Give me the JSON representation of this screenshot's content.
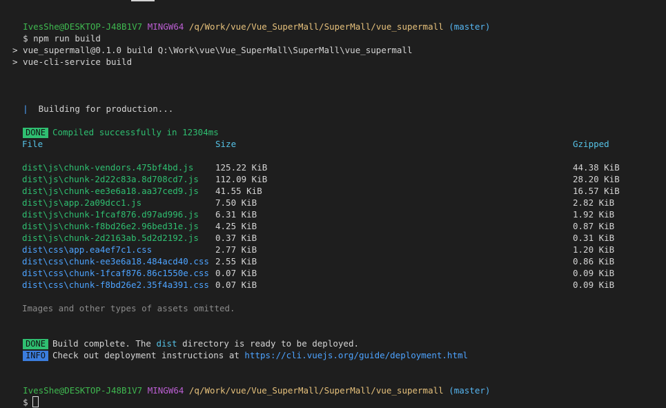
{
  "prompt": {
    "user": "IvesShe@DESKTOP-J48B1V7",
    "env": "MINGW64",
    "path": "/q/Work/vue/Vue_SuperMall/SuperMall/vue_supermall",
    "branch": "(master)",
    "symbol": "$"
  },
  "command": "npm run build",
  "script_lines": [
    "> vue_supermall@0.1.0 build Q:\\Work\\vue\\Vue_SuperMall\\SuperMall\\vue_supermall",
    "> vue-cli-service build"
  ],
  "building": {
    "bar": "|",
    "text": "Building for production..."
  },
  "compiled": {
    "badge": "DONE",
    "text": "Compiled successfully in 12304ms"
  },
  "table": {
    "headers": {
      "file": "File",
      "size": "Size",
      "gzipped": "Gzipped"
    },
    "rows": [
      {
        "file": "dist\\js\\chunk-vendors.475bf4bd.js",
        "size": "125.22 KiB",
        "gzipped": "44.38 KiB",
        "kind": "js"
      },
      {
        "file": "dist\\js\\chunk-2d22c83a.8d708cd7.js",
        "size": "112.09 KiB",
        "gzipped": "28.20 KiB",
        "kind": "js"
      },
      {
        "file": "dist\\js\\chunk-ee3e6a18.aa37ced9.js",
        "size": "41.55 KiB",
        "gzipped": "16.57 KiB",
        "kind": "js"
      },
      {
        "file": "dist\\js\\app.2a09dcc1.js",
        "size": "7.50 KiB",
        "gzipped": "2.82 KiB",
        "kind": "js"
      },
      {
        "file": "dist\\js\\chunk-1fcaf876.d97ad996.js",
        "size": "6.31 KiB",
        "gzipped": "1.92 KiB",
        "kind": "js"
      },
      {
        "file": "dist\\js\\chunk-f8bd26e2.96bed31e.js",
        "size": "4.25 KiB",
        "gzipped": "0.87 KiB",
        "kind": "js"
      },
      {
        "file": "dist\\js\\chunk-2d2163ab.5d2d2192.js",
        "size": "0.37 KiB",
        "gzipped": "0.31 KiB",
        "kind": "js"
      },
      {
        "file": "dist\\css\\app.ea4ef7c1.css",
        "size": "2.77 KiB",
        "gzipped": "1.20 KiB",
        "kind": "css"
      },
      {
        "file": "dist\\css\\chunk-ee3e6a18.484acd40.css",
        "size": "2.55 KiB",
        "gzipped": "0.86 KiB",
        "kind": "css"
      },
      {
        "file": "dist\\css\\chunk-1fcaf876.86c1550e.css",
        "size": "0.07 KiB",
        "gzipped": "0.09 KiB",
        "kind": "css"
      },
      {
        "file": "dist\\css\\chunk-f8bd26e2.35f4a391.css",
        "size": "0.07 KiB",
        "gzipped": "0.09 KiB",
        "kind": "css"
      }
    ]
  },
  "omitted_note": "Images and other types of assets omitted.",
  "build_complete": {
    "badge": "DONE",
    "pre": "Build complete. The ",
    "dist": "dist",
    "post": " directory is ready to be deployed."
  },
  "info": {
    "badge": "INFO",
    "pre": "Check out deployment instructions at ",
    "link": "https://cli.vuejs.org/guide/deployment.html"
  },
  "colors": {
    "background": "#1e1e1e",
    "user": "#3fb950",
    "env": "#bc5fd3",
    "path": "#e5c07b",
    "branch": "#56b6f2",
    "done_badge": "#2fbf71",
    "info_badge": "#3b7ddd"
  }
}
